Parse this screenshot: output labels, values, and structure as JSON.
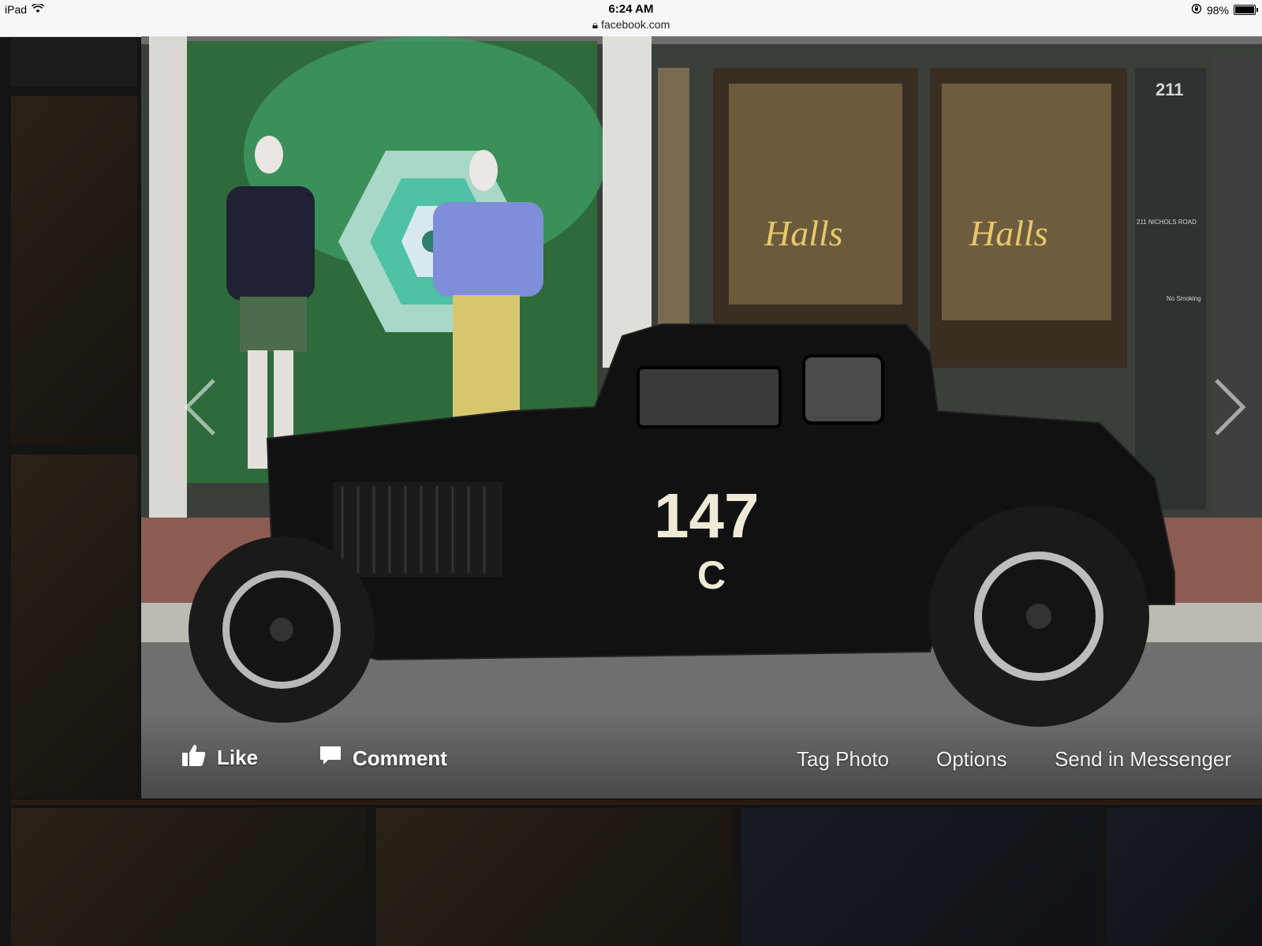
{
  "status_bar": {
    "device": "iPad",
    "time": "6:24 AM",
    "url": "facebook.com",
    "battery": "98%"
  },
  "photo": {
    "storefront_number": "211",
    "car_number": "147",
    "car_class": "C",
    "address_sign": "211 NICHOLS ROAD",
    "no_smoking": "No Smoking"
  },
  "actions": {
    "like": "Like",
    "comment": "Comment",
    "tag_photo": "Tag Photo",
    "options": "Options",
    "send_in_messenger": "Send in Messenger"
  }
}
